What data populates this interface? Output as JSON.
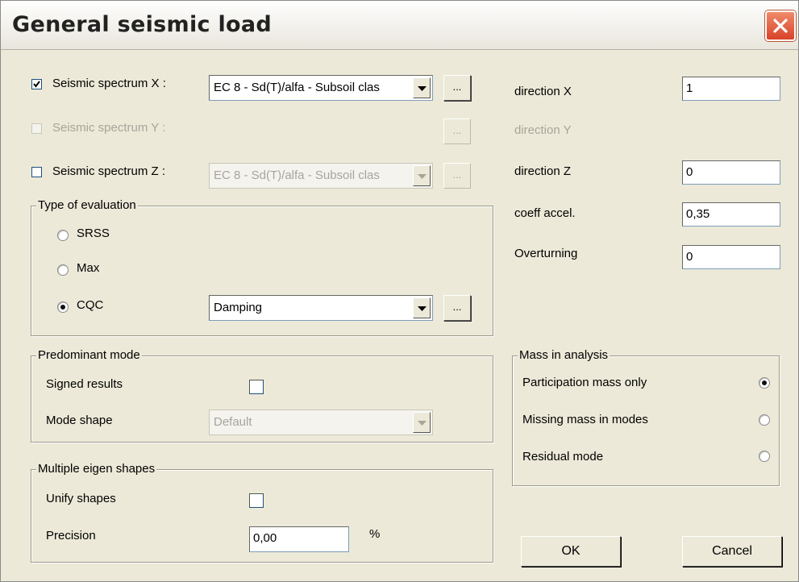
{
  "window": {
    "title": "General seismic load"
  },
  "spectrum": {
    "x": {
      "label": "Seismic spectrum X :",
      "checked": true,
      "value": "EC 8 - Sd(T)/alfa - Subsoil clas",
      "browse": "..."
    },
    "y": {
      "label": "Seismic spectrum Y :",
      "checked": false,
      "browse": "..."
    },
    "z": {
      "label": "Seismic spectrum Z :",
      "checked": false,
      "value": "EC 8 - Sd(T)/alfa - Subsoil clas",
      "browse": "..."
    }
  },
  "directions": {
    "x": {
      "label": "direction X",
      "value": "1"
    },
    "y": {
      "label": "direction Y"
    },
    "z": {
      "label": "direction Z",
      "value": "0"
    },
    "coeff": {
      "label": "coeff accel.",
      "value": "0,35"
    },
    "overturning": {
      "label": "Overturning",
      "value": "0"
    }
  },
  "evaluation": {
    "legend": "Type of evaluation",
    "options": [
      "SRSS",
      "Max",
      "CQC"
    ],
    "selected": "CQC",
    "damping": "Damping",
    "browse": "..."
  },
  "predominant": {
    "legend": "Predominant mode",
    "signed_label": "Signed results",
    "signed_checked": false,
    "mode_label": "Mode shape",
    "mode_value": "Default"
  },
  "multiple": {
    "legend": "Multiple eigen shapes",
    "unify_label": "Unify shapes",
    "unify_checked": false,
    "precision_label": "Precision",
    "precision_value": "0,00",
    "precision_unit": "%"
  },
  "mass": {
    "legend": "Mass in analysis",
    "options": [
      "Participation mass only",
      "Missing mass in modes",
      "Residual mode"
    ],
    "selected": "Participation mass only"
  },
  "buttons": {
    "ok": "OK",
    "cancel": "Cancel"
  },
  "colors": {
    "close_button": "#d8432a",
    "dialog_bg": "#ece9d8",
    "disabled_text": "#a7a59a"
  }
}
